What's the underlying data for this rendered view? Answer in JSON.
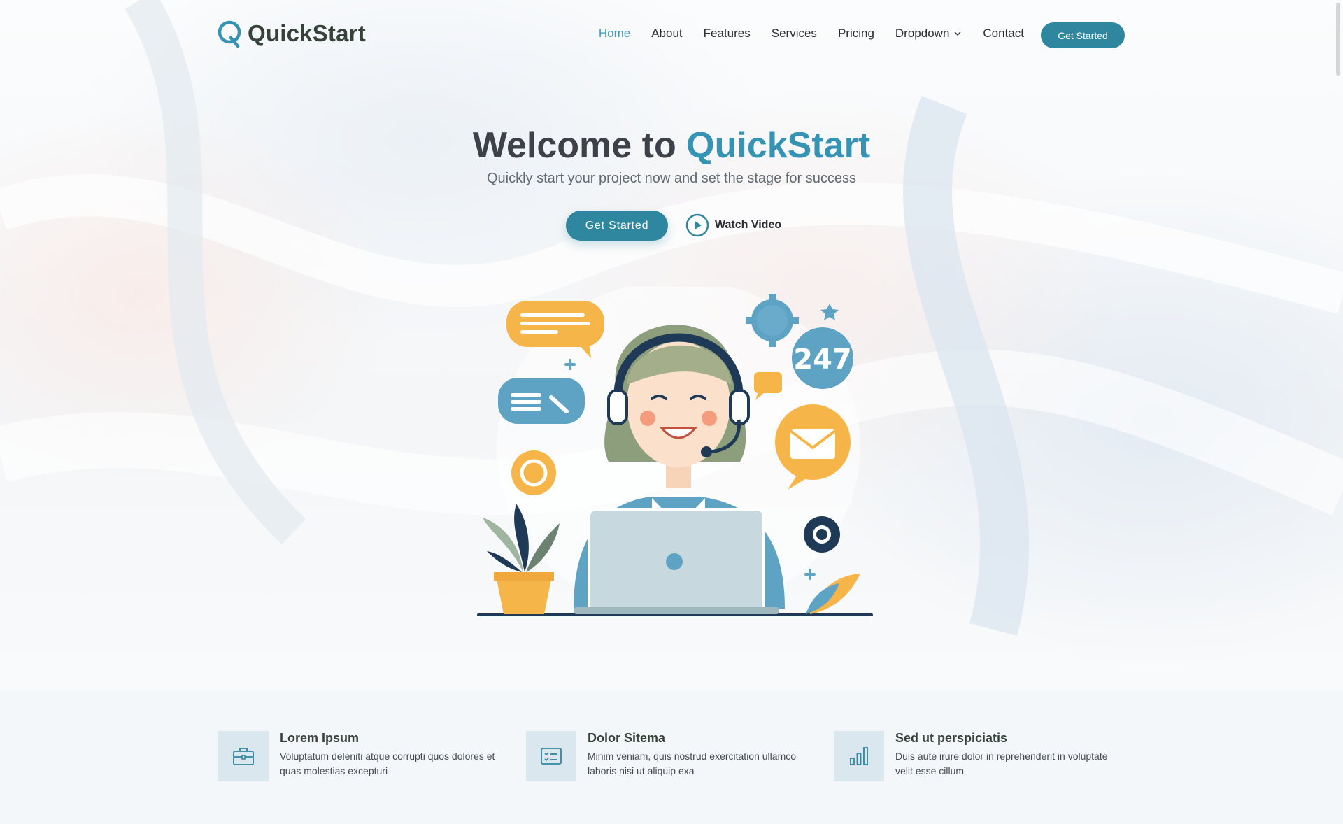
{
  "brand": {
    "name": "QuickStart",
    "accent": "#3593b3",
    "button_color": "#2e879e"
  },
  "nav": {
    "items": [
      {
        "label": "Home",
        "active": true
      },
      {
        "label": "About"
      },
      {
        "label": "Features"
      },
      {
        "label": "Services"
      },
      {
        "label": "Pricing"
      },
      {
        "label": "Dropdown",
        "icon": "chevron-down-icon"
      },
      {
        "label": "Contact"
      }
    ],
    "cta_label": "Get Started"
  },
  "hero": {
    "title_prefix": "Welcome to",
    "title_accent": "QuickStart",
    "subtitle": "Quickly start your project now and set the stage for success",
    "cta_label": "Get Started",
    "video_label": "Watch Video",
    "illustration_badge": "247"
  },
  "features": [
    {
      "icon": "briefcase-icon",
      "title": "Lorem Ipsum",
      "desc": "Voluptatum deleniti atque corrupti quos dolores et quas molestias excepturi"
    },
    {
      "icon": "card-checklist-icon",
      "title": "Dolor Sitema",
      "desc": "Minim veniam, quis nostrud exercitation ullamco laboris nisi ut aliquip exa"
    },
    {
      "icon": "bar-chart-icon",
      "title": "Sed ut perspiciatis",
      "desc": "Duis aute irure dolor in reprehenderit in voluptate velit esse cillum"
    }
  ]
}
